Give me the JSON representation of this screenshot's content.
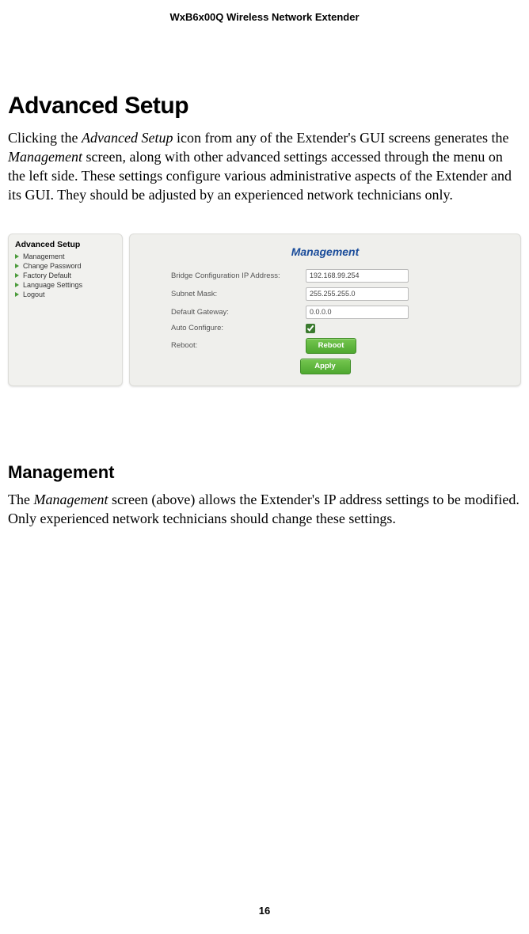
{
  "header": "WxB6x00Q Wireless Network Extender",
  "section1": {
    "title": "Advanced Setup",
    "para_parts": {
      "p1": "Clicking the ",
      "i1": "Advanced Setup",
      "p2": " icon from any of the Extender's GUI screens generates the ",
      "i2": "Management",
      "p3": " screen, along with other advanced settings accessed through the menu on the left side. These settings configure various administrative aspects of the Extender and its GUI. They should be adjusted by an experienced network technicians only."
    }
  },
  "gui": {
    "sidebar": {
      "title": "Advanced Setup",
      "items": [
        {
          "label": "Management"
        },
        {
          "label": "Change Password"
        },
        {
          "label": "Factory Default"
        },
        {
          "label": "Language Settings"
        },
        {
          "label": "Logout"
        }
      ]
    },
    "panel": {
      "title": "Management",
      "bridge_label": "Bridge Configuration IP Address:",
      "bridge_value": "192.168.99.254",
      "subnet_label": "Subnet Mask:",
      "subnet_value": "255.255.255.0",
      "gateway_label": "Default Gateway:",
      "gateway_value": "0.0.0.0",
      "auto_label": "Auto Configure:",
      "auto_checked": "checked",
      "reboot_label": "Reboot:",
      "reboot_btn": "Reboot",
      "apply_btn": "Apply"
    }
  },
  "section2": {
    "title": "Management",
    "para_parts": {
      "p1": "The ",
      "i1": "Management",
      "p2": " screen (above) allows the Extender's IP address settings to be modified. Only experienced network technicians should change these settings."
    }
  },
  "page_number": "16"
}
